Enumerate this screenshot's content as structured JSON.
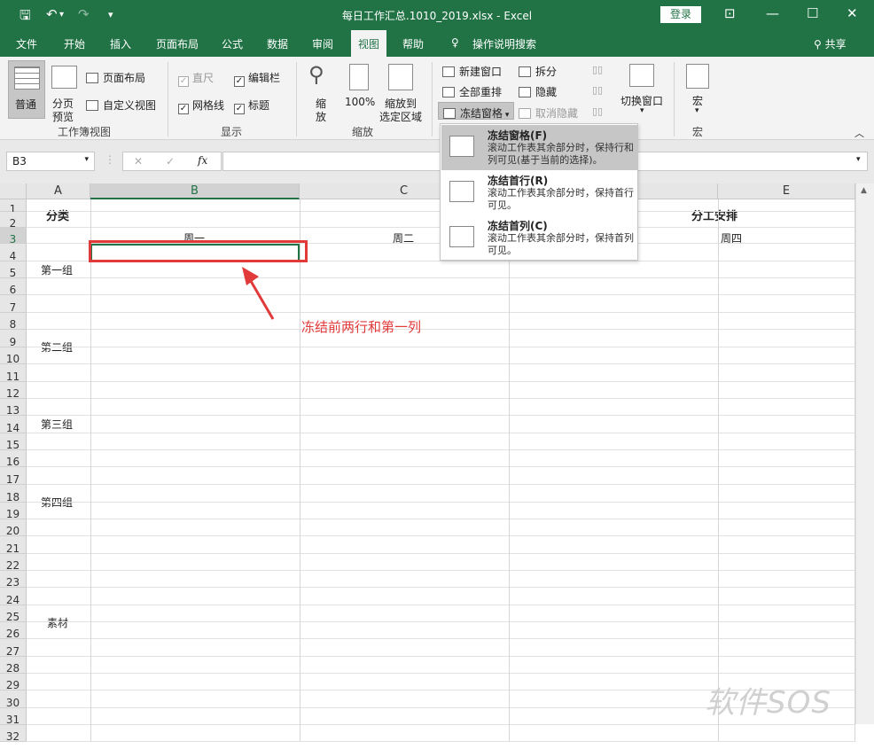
{
  "titlebar": {
    "title": "每日工作汇总.1010_2019.xlsx  -  Excel",
    "login": "登录"
  },
  "tabs": [
    "文件",
    "开始",
    "插入",
    "页面布局",
    "公式",
    "数据",
    "审阅",
    "视图",
    "帮助"
  ],
  "active_tab": "视图",
  "tell_me": "操作说明搜索",
  "share": "共享",
  "ribbon": {
    "workbook_views": {
      "label": "工作簿视图",
      "normal": "普通",
      "page_break_1": "分页",
      "page_break_2": "预览",
      "page_layout": "页面布局",
      "custom_views": "自定义视图"
    },
    "show": {
      "label": "显示",
      "ruler": "直尺",
      "formula_bar": "编辑栏",
      "gridlines": "网格线",
      "headings": "标题"
    },
    "zoom": {
      "label": "缩放",
      "zoom_1": "缩",
      "zoom_2": "放",
      "pct": "100%",
      "to_sel_1": "缩放到",
      "to_sel_2": "选定区域"
    },
    "window": {
      "new_window": "新建窗口",
      "arrange_all": "全部重排",
      "freeze_panes": "冻结窗格",
      "split": "拆分",
      "hide": "隐藏",
      "unhide": "取消隐藏",
      "switch_windows": "切换窗口"
    },
    "macros": {
      "label": "宏",
      "button": "宏"
    }
  },
  "formula_bar": {
    "name_box": "B3",
    "fx": "fx",
    "cancel": "✕",
    "enter": "✓",
    "formula": ""
  },
  "columns": [
    "A",
    "B",
    "C",
    "D",
    "E"
  ],
  "rows": [
    "1",
    "2",
    "3",
    "4",
    "5",
    "6",
    "7",
    "8",
    "9",
    "10",
    "11",
    "12",
    "13",
    "14",
    "15",
    "16",
    "17",
    "18",
    "19",
    "20",
    "21",
    "22",
    "23",
    "24",
    "25",
    "26",
    "27",
    "28",
    "29",
    "30",
    "31",
    "32"
  ],
  "sheet": {
    "a1": "分类",
    "header_title": "分工安排",
    "b2": "周一",
    "c2": "周二",
    "e2": "周四",
    "group1": "第一组",
    "group2": "第二组",
    "group3": "第三组",
    "group4": "第四组",
    "material": "素材"
  },
  "freeze_menu": [
    {
      "title": "冻结窗格(F)",
      "desc": "滚动工作表其余部分时，保持行和列可见(基于当前的选择)。"
    },
    {
      "title": "冻结首行(R)",
      "desc": "滚动工作表其余部分时，保持首行可见。"
    },
    {
      "title": "冻结首列(C)",
      "desc": "滚动工作表其余部分时，保持首列可见。"
    }
  ],
  "annotation": "冻结前两行和第一列",
  "watermark": "软件SOS",
  "colors": {
    "excel_green": "#217346",
    "annotation_red": "#e03a3a"
  }
}
